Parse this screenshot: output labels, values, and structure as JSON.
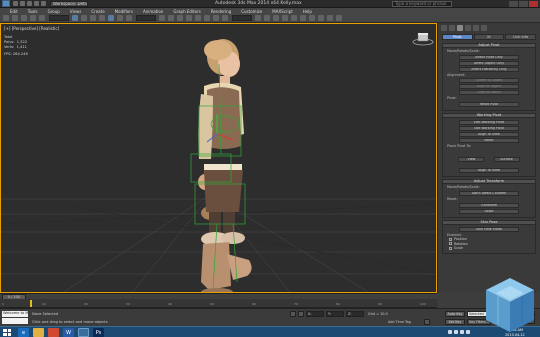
{
  "window": {
    "title": "Autodesk 3ds Max 2014 x64     Kelly.max",
    "workspace": "Workspace: Default",
    "help_search": "Type a keyword or phrase"
  },
  "menu": [
    "Edit",
    "Tools",
    "Group",
    "Views",
    "Create",
    "Modifiers",
    "Animation",
    "Graph Editors",
    "Rendering",
    "Customize",
    "MAXScript",
    "Help"
  ],
  "viewport": {
    "label": "[+] [Perspective] [Realistic]",
    "stats": "Total\nPolys:  1,322\nVerts:  1,411",
    "fps": "FPS:    264.246",
    "active_border_color": "#e6a000",
    "grid_color": "#555555",
    "bg_color": "#2d2d2d"
  },
  "command_panel": {
    "subtabs": [
      "Pivot",
      "IK",
      "Link Info"
    ],
    "adjust_pivot": {
      "header": "Adjust Pivot",
      "move_label": "Move/Rotate/Scale:",
      "buttons": [
        "Affect Pivot Only",
        "Affect Object Only",
        "Affect Hierarchy Only"
      ],
      "alignment_label": "Alignment:",
      "align_buttons": [
        "Center to Object",
        "Align to Object",
        "Align to World"
      ],
      "pivot_label": "Pivot:",
      "reset_button": "Reset Pivot"
    },
    "working_pivot": {
      "header": "Working Pivot",
      "buttons": [
        "Edit Working Pivot",
        "Use Working Pivot",
        "Align To View",
        "Reset"
      ],
      "place_label": "Place Pivot To:",
      "place_buttons": [
        "View",
        "Surface"
      ],
      "align_check": "Align To View"
    },
    "adjust_transform": {
      "header": "Adjust Transform",
      "move_label": "Move/Rotate/Scale:",
      "button": "Don't Affect Children",
      "reset_label": "Reset:",
      "reset_buttons": [
        "Transform",
        "Scale"
      ]
    },
    "skin_pose": {
      "header": "Skin Pose",
      "button": "Skin Pose Mode",
      "enabled_label": "Enabled:",
      "checks": [
        "Position",
        "Rotation",
        "Scale"
      ]
    }
  },
  "timeline": {
    "slider_label": "0 / 100",
    "ticks": [
      "0",
      "10",
      "20",
      "30",
      "40",
      "50",
      "60",
      "70",
      "80",
      "90",
      "100"
    ]
  },
  "status": {
    "maxscript": "Welcome to MA",
    "line1": "None Selected",
    "line2": "Click and drag to select and move objects",
    "coord_x_label": "X:",
    "coord_y_label": "Y:",
    "coord_z_label": "Z:",
    "grid": "Grid = 10.0",
    "auto_key": "Auto Key",
    "selected": "Selected",
    "set_key": "Set Key",
    "key_filters": "Key Filters...",
    "add_time_tag": "Add Time Tag"
  },
  "taskbar": {
    "apps": [
      "ie-icon",
      "explorer-icon",
      "chrome-icon",
      "word-icon",
      "3dsmax-icon",
      "photoshop-icon"
    ],
    "clock_time": "10:06 AM",
    "clock_date": "2013-04-12"
  }
}
